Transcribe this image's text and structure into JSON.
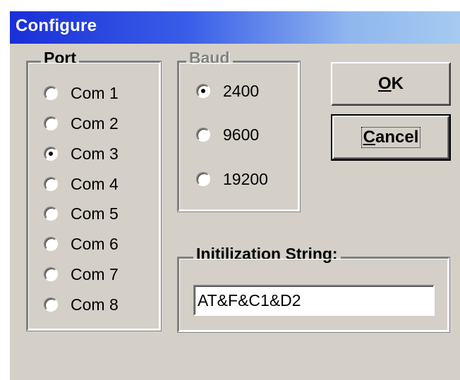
{
  "window": {
    "title": "Configure"
  },
  "port_group": {
    "label": "Port",
    "options": [
      {
        "label": "Com 1",
        "checked": false
      },
      {
        "label": "Com 2",
        "checked": false
      },
      {
        "label": "Com 3",
        "checked": true
      },
      {
        "label": "Com 4",
        "checked": false
      },
      {
        "label": "Com 5",
        "checked": false
      },
      {
        "label": "Com 6",
        "checked": false
      },
      {
        "label": "Com 7",
        "checked": false
      },
      {
        "label": "Com 8",
        "checked": false
      }
    ]
  },
  "baud_group": {
    "label": "Baud",
    "disabled": true,
    "options": [
      {
        "label": "2400",
        "checked": true
      },
      {
        "label": "9600",
        "checked": false
      },
      {
        "label": "19200",
        "checked": false
      }
    ]
  },
  "buttons": {
    "ok": {
      "accelerator": "O",
      "rest": "K"
    },
    "cancel": {
      "accelerator": "C",
      "rest": "ancel"
    }
  },
  "init_group": {
    "label": "Initilization String:",
    "value": "AT&F&C1&D2"
  },
  "colors": {
    "dialog_bg": "#d4d0c8",
    "titlebar_start": "#1a2fd8",
    "titlebar_end": "#a6caf0",
    "title_text": "#ffffff",
    "disabled_text": "#808080"
  }
}
